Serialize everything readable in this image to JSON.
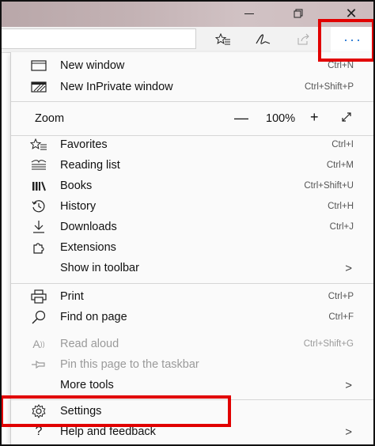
{
  "window": {
    "close_glyph": "✕"
  },
  "toolbar": {
    "more_label": "···"
  },
  "menu": {
    "items_top": [
      {
        "label": "New window",
        "shortcut": "Ctrl+N",
        "icon": "window-icon"
      },
      {
        "label": "New InPrivate window",
        "shortcut": "Ctrl+Shift+P",
        "icon": "inprivate-icon"
      }
    ],
    "zoom": {
      "label": "Zoom",
      "minus": "—",
      "value": "100%",
      "plus": "+",
      "fullscreen_icon": "expand-icon"
    },
    "items_mid": [
      {
        "label": "Favorites",
        "shortcut": "Ctrl+I",
        "icon": "favorites-icon"
      },
      {
        "label": "Reading list",
        "shortcut": "Ctrl+M",
        "icon": "reading-list-icon"
      },
      {
        "label": "Books",
        "shortcut": "Ctrl+Shift+U",
        "icon": "books-icon"
      },
      {
        "label": "History",
        "shortcut": "Ctrl+H",
        "icon": "history-icon"
      },
      {
        "label": "Downloads",
        "shortcut": "Ctrl+J",
        "icon": "download-icon"
      },
      {
        "label": "Extensions",
        "shortcut": "",
        "icon": "extensions-icon"
      },
      {
        "label": "Show in toolbar",
        "chevron": ">"
      }
    ],
    "items_tools": [
      {
        "label": "Print",
        "shortcut": "Ctrl+P",
        "icon": "print-icon"
      },
      {
        "label": "Find on page",
        "shortcut": "Ctrl+F",
        "icon": "search-icon"
      },
      {
        "label": "Read aloud",
        "shortcut": "Ctrl+Shift+G",
        "icon": "read-aloud-icon",
        "disabled": true
      },
      {
        "label": "Pin this page to the taskbar",
        "icon": "pin-icon",
        "disabled": true
      },
      {
        "label": "More tools",
        "chevron": ">"
      }
    ],
    "items_bottom": [
      {
        "label": "Settings",
        "icon": "gear-icon"
      },
      {
        "label": "Help and feedback",
        "icon": "help-icon",
        "chevron": ">"
      }
    ]
  },
  "colors": {
    "highlight": "#e10000",
    "accent": "#1a6fd1"
  }
}
